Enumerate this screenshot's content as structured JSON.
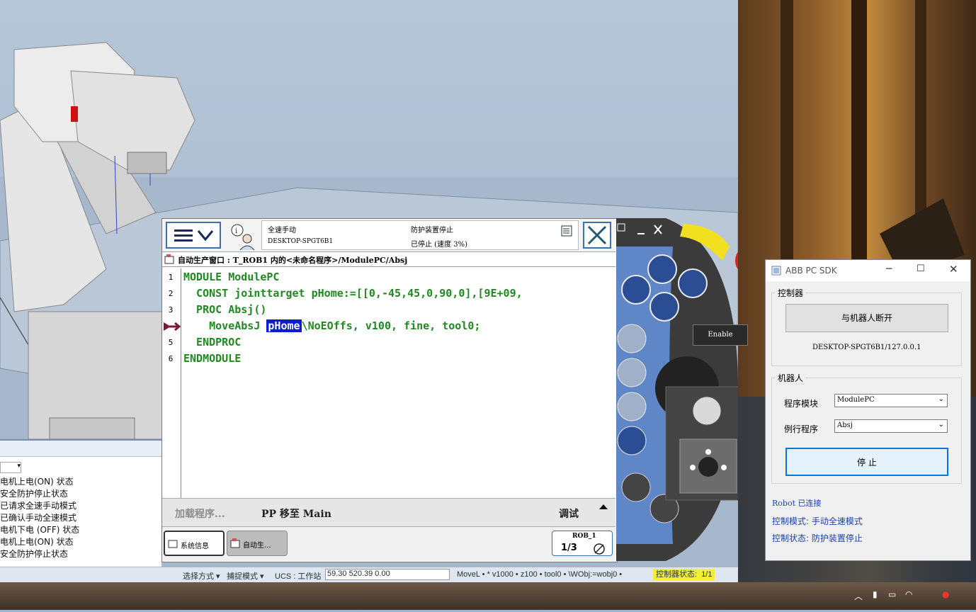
{
  "rs_output": {
    "log": [
      "电机上电(ON) 状态",
      "安全防护停止状态",
      "已请求全速手动模式",
      "已确认手动全速模式",
      "电机下电 (OFF) 状态",
      "电机上电(ON) 状态",
      "安全防护停止状态"
    ]
  },
  "rs_status": {
    "select_mode": "选择方式",
    "snap_mode": "捕捉模式",
    "ucs": "UCS : 工作站",
    "coords": "59.30   520.39   0.00",
    "move": "MoveL  •  *  v1000  •  z100  •  tool0  •  \\WObj:=wobj0  •",
    "ctrl_status_label": "控制器状态:",
    "ctrl_status_value": "1/1"
  },
  "flexpendant": {
    "status": {
      "mode": "全速手动",
      "controller": "DESKTOP-SPGT6B1",
      "guard": "防护装置停止",
      "state": "已停止 (速度 3%)"
    },
    "breadcrumb": "自动生产窗口 : T_ROB1 内的<未命名程序>/ModulePC/Absj",
    "code_lines": [
      {
        "no": "1",
        "pre": "MODULE ModulePC",
        "hl": "",
        "post": ""
      },
      {
        "no": "2",
        "pre": "  CONST jointtarget pHome:=[[0,-45,45,0,90,0],[9E+09,",
        "hl": "",
        "post": ""
      },
      {
        "no": "3",
        "pre": "  PROC Absj()",
        "hl": "",
        "post": ""
      },
      {
        "no": "",
        "pre": "    MoveAbsJ ",
        "hl": "pHome",
        "post": "\\NoEOffs, v100, fine, tool0;"
      },
      {
        "no": "5",
        "pre": "  ENDPROC",
        "hl": "",
        "post": ""
      },
      {
        "no": "6",
        "pre": "ENDMODULE",
        "hl": "",
        "post": ""
      }
    ],
    "commands": {
      "load": "加载程序...",
      "pp_main": "PP 移至 Main",
      "debug": "调试"
    },
    "tasks": {
      "sysinfo": "系统信息",
      "autoprod": "自动生...",
      "rob": "ROB_1",
      "speed": "1/3"
    },
    "enable_label": "Enable"
  },
  "sdk": {
    "title": "ABB PC SDK",
    "controller_group": "控制器",
    "disconnect_btn": "与机器人断开",
    "address": "DESKTOP-SPGT6B1/127.0.0.1",
    "robot_group": "机器人",
    "module_label": "程序模块",
    "module_value": "ModulePC",
    "routine_label": "例行程序",
    "routine_value": "Absj",
    "stop_btn": "停 止",
    "robot_connected": "Robot 已连接",
    "control_mode": "控制模式: 手动全速模式",
    "control_state": "控制状态: 防护装置停止"
  },
  "colors": {
    "code": "#1f8a1f",
    "highlight": "#0a1fc8",
    "accent": "#3a6fb0",
    "sdk_status": "#1c3fa8"
  }
}
